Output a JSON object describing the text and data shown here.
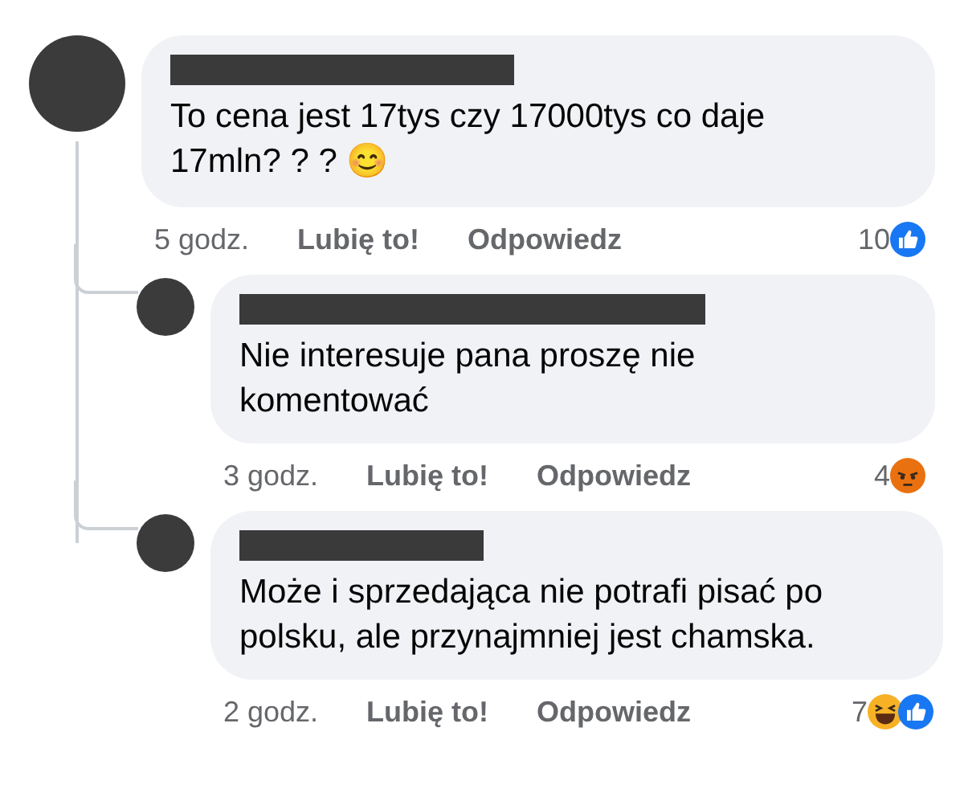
{
  "comment": {
    "text": "To cena jest 17tys czy 17000tys co daje 17mln? ? ? 😊",
    "time": "5 godz.",
    "like_label": "Lubię to!",
    "reply_label": "Odpowiedz",
    "reaction_count": "10",
    "reactions": [
      {
        "kind": "like"
      }
    ],
    "replies": [
      {
        "text": "Nie interesuje pana proszę nie komentować",
        "time": "3 godz.",
        "like_label": "Lubię to!",
        "reply_label": "Odpowiedz",
        "reaction_count": "4",
        "reactions": [
          {
            "kind": "angry"
          }
        ]
      },
      {
        "text": "Może i sprzedająca nie potrafi pisać po polsku, ale przynajmniej jest chamska.",
        "time": "2 godz.",
        "like_label": "Lubię to!",
        "reply_label": "Odpowiedz",
        "reaction_count": "7",
        "reactions": [
          {
            "kind": "haha"
          },
          {
            "kind": "like"
          }
        ]
      }
    ]
  }
}
